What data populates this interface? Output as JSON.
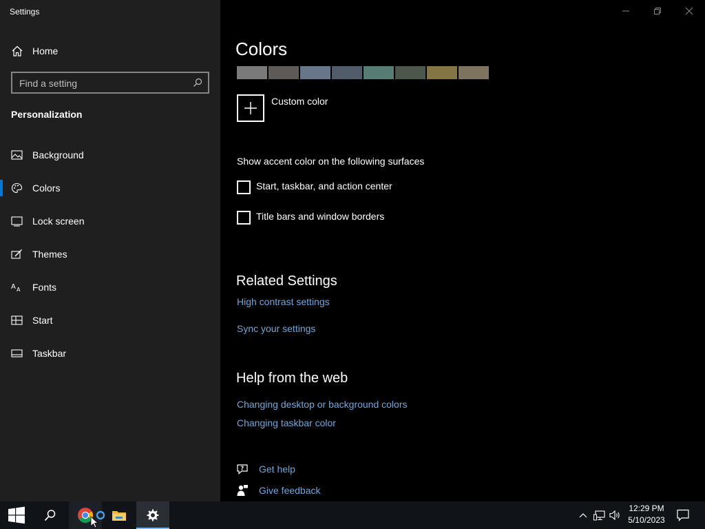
{
  "window": {
    "title": "Settings",
    "controls": [
      "minimize-icon",
      "restore-icon",
      "close-icon"
    ]
  },
  "sidebar": {
    "home_label": "Home",
    "search_placeholder": "Find a setting",
    "section_title": "Personalization",
    "items": [
      {
        "label": "Background",
        "icon": "image-icon",
        "selected": false
      },
      {
        "label": "Colors",
        "icon": "palette-icon",
        "selected": true
      },
      {
        "label": "Lock screen",
        "icon": "lock-screen-icon",
        "selected": false
      },
      {
        "label": "Themes",
        "icon": "themes-icon",
        "selected": false
      },
      {
        "label": "Fonts",
        "icon": "fonts-icon",
        "selected": false
      },
      {
        "label": "Start",
        "icon": "start-icon",
        "selected": false
      },
      {
        "label": "Taskbar",
        "icon": "taskbar-icon",
        "selected": false
      }
    ]
  },
  "main": {
    "title": "Colors",
    "swatches": [
      "#7a7a7a",
      "#5d5a58",
      "#68768a",
      "#515c6b",
      "#567c73",
      "#4c574c",
      "#847545",
      "#7e735f"
    ],
    "custom_color_label": "Custom color",
    "accent_surfaces": {
      "heading": "Show accent color on the following surfaces",
      "options": [
        {
          "label": "Start, taskbar, and action center",
          "checked": false
        },
        {
          "label": "Title bars and window borders",
          "checked": false
        }
      ]
    },
    "related": {
      "heading": "Related Settings",
      "links": [
        "High contrast settings",
        "Sync your settings"
      ]
    },
    "help_web": {
      "heading": "Help from the web",
      "links": [
        "Changing desktop or background colors",
        "Changing taskbar color"
      ]
    },
    "support": {
      "get_help": "Get help",
      "give_feedback": "Give feedback"
    }
  },
  "taskbar": {
    "time": "12:29 PM",
    "date": "5/10/2023",
    "icons": [
      "windows-start-icon",
      "search-icon",
      "chrome-icon",
      "cortana-icon",
      "file-explorer-icon",
      "settings-gear-icon"
    ],
    "tray": [
      "chevron-up-icon",
      "network-icon",
      "volume-icon",
      "notification-icon"
    ]
  },
  "colors": {
    "accent": "#0078d7",
    "link": "#6fa8dc",
    "sidebar_bg": "#1f1f1f",
    "content_bg": "#000000",
    "taskbar_bg": "#101418"
  }
}
